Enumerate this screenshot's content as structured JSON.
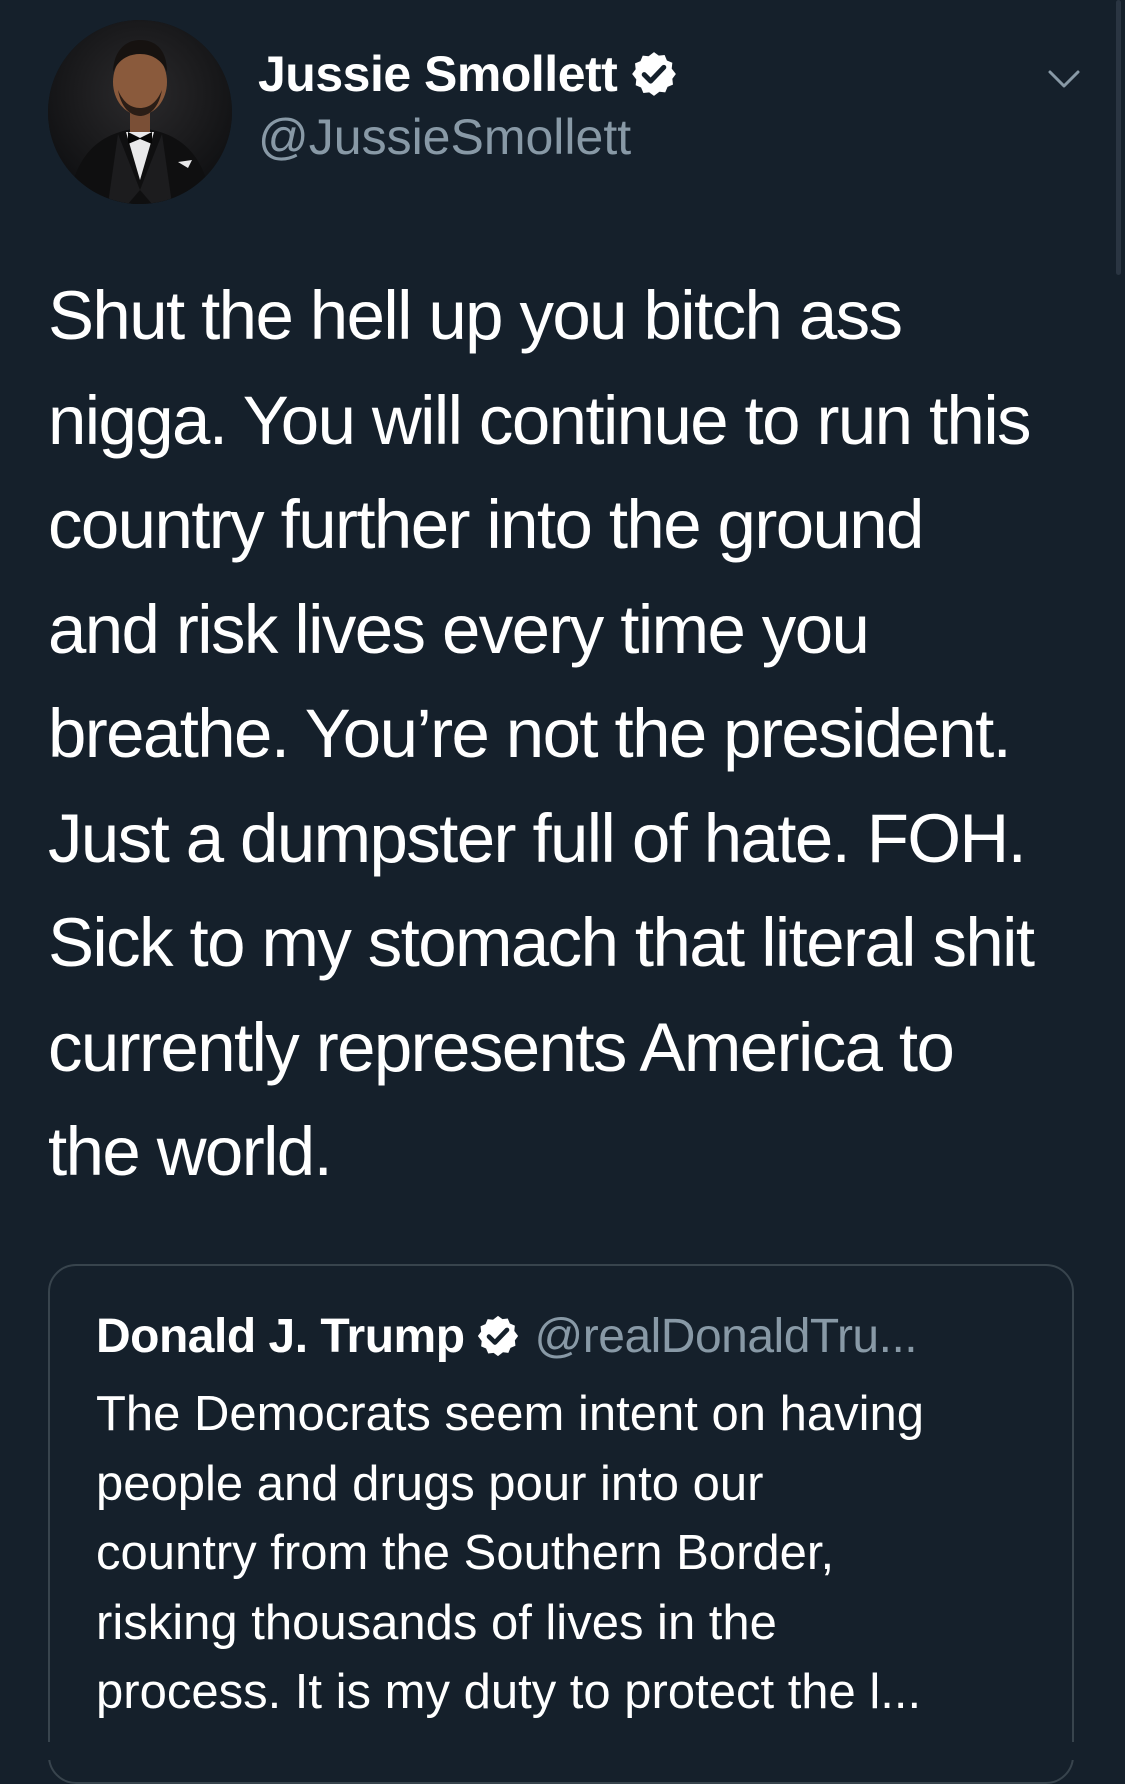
{
  "tweet": {
    "author": {
      "display_name": "Jussie Smollett",
      "handle": "@JussieSmollett",
      "verified": true,
      "avatar_icon": "profile-photo"
    },
    "menu_icon": "chevron-down-icon",
    "text_lines": [
      "Shut the hell up you bitch ass",
      "nigga. You will continue to run this",
      "country further into the ground",
      "and risk lives every time you",
      "breathe. You’re not the president.",
      "Just a dumpster full of hate. FOH.",
      "Sick to my stomach that literal shit",
      "currently represents America to",
      "the world."
    ]
  },
  "quoted_tweet": {
    "display_name": "Donald J. Trump",
    "handle": "@realDonaldTru...",
    "verified": true,
    "text_lines": [
      "The Democrats seem intent on having",
      "people and drugs pour into our",
      "country from the Southern Border,",
      "risking thousands of lives in the",
      "process. It is my duty to protect the l..."
    ]
  },
  "colors": {
    "background": "#15202b",
    "primary_text": "#ffffff",
    "secondary_text": "#8899a6",
    "border": "#38444d"
  }
}
